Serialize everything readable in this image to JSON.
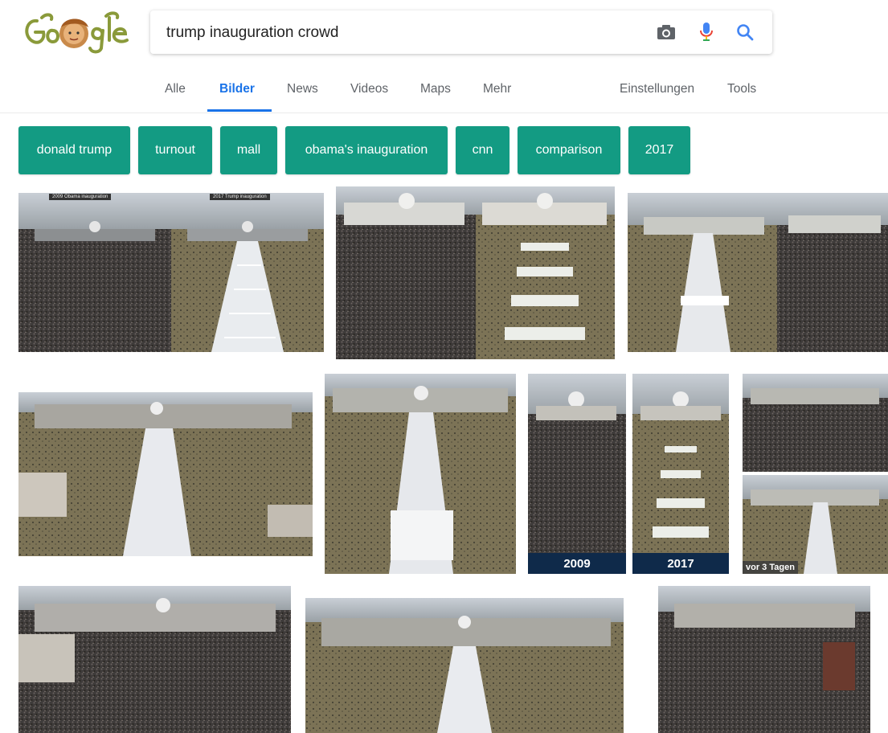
{
  "search": {
    "query": "trump inauguration crowd"
  },
  "icons": {
    "camera": "camera-icon",
    "mic": "microphone-icon",
    "search": "search-icon"
  },
  "colors": {
    "chip_bg": "#139b83",
    "active_tab": "#1a73e8",
    "year_band": "#0f2a4a"
  },
  "tabs": [
    {
      "label": "Alle",
      "active": false
    },
    {
      "label": "Bilder",
      "active": true
    },
    {
      "label": "News",
      "active": false
    },
    {
      "label": "Videos",
      "active": false
    },
    {
      "label": "Maps",
      "active": false
    },
    {
      "label": "Mehr",
      "active": false
    }
  ],
  "tools": {
    "settings": "Einstellungen",
    "tools": "Tools"
  },
  "chips": [
    "donald trump",
    "turnout",
    "mall",
    "obama's inauguration",
    "cnn",
    "comparison",
    "2017"
  ],
  "images": {
    "r1a": {
      "left_tag": "2009 Obama inauguration",
      "right_tag": "2017 Trump inauguration"
    },
    "r2c": {
      "left_year": "2009",
      "right_year": "2017"
    },
    "r2d": {
      "age": "vor 3 Tagen"
    }
  }
}
